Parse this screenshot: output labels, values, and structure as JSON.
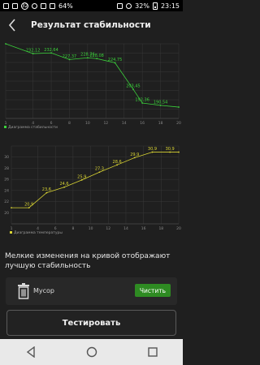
{
  "status_bar": {
    "left_badge": "32",
    "battery_left": "64%",
    "battery_right": "32%",
    "time": "23:15"
  },
  "header": {
    "title": "Результат стабильности"
  },
  "chart_data": [
    {
      "type": "line",
      "color": "#3bd23b",
      "legend": "Диаграмма стабильности",
      "x": [
        1,
        4,
        6,
        8,
        10,
        11,
        13,
        15,
        16,
        18,
        20
      ],
      "values": [
        4290,
        232.12,
        232.64,
        227.37,
        228.76,
        228.08,
        224.75,
        203.45,
        192.36,
        190.54,
        189.1
      ],
      "labels": [
        "",
        "232,12",
        "232,64",
        "227,37",
        "228,76",
        "228,08",
        "224,75",
        "203,45",
        "192,36",
        "190,54",
        ""
      ],
      "x_ticks": [
        "1",
        "4",
        "6",
        "8",
        "10",
        "12",
        "14",
        "16",
        "18",
        "20"
      ]
    },
    {
      "type": "line",
      "color": "#d9d433",
      "legend": "Диаграмма температуры",
      "x": [
        1,
        3,
        5,
        7,
        9,
        11,
        13,
        15,
        17,
        19,
        20
      ],
      "values": [
        20.9,
        20.9,
        23.6,
        24.6,
        25.9,
        27.3,
        28.6,
        29.9,
        30.9,
        30.9,
        30.9
      ],
      "labels": [
        "",
        "20,9",
        "23,6",
        "24,6",
        "25,9",
        "27,3",
        "28,6",
        "29,9",
        "30,9",
        "30,9",
        ""
      ],
      "x_ticks": [
        "1",
        "4",
        "6",
        "8",
        "10",
        "12",
        "14",
        "16",
        "18",
        "20"
      ],
      "y_ticks": [
        "20",
        "22",
        "24",
        "26",
        "28",
        "30"
      ]
    }
  ],
  "info": {
    "text": "Мелкие изменения на кривой отображают лучшую стабильность"
  },
  "trash": {
    "label": "Мусор",
    "button": "Чистить"
  },
  "actions": {
    "test_button": "Тестировать"
  }
}
